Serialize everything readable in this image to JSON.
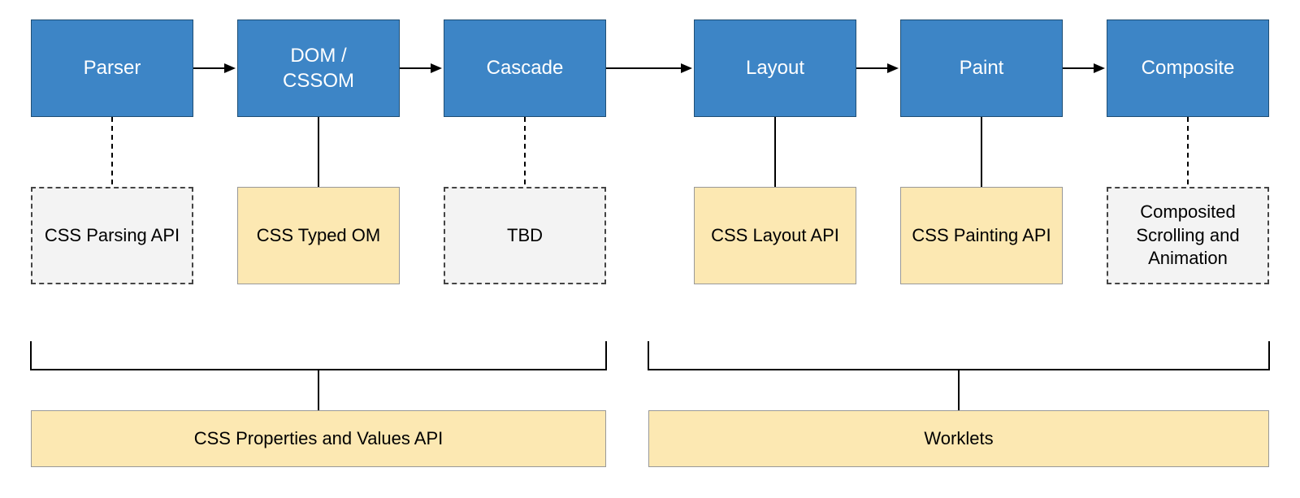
{
  "stages": {
    "parser": "Parser",
    "dom": "DOM /\nCSSOM",
    "cascade": "Cascade",
    "layout": "Layout",
    "paint": "Paint",
    "composite": "Composite"
  },
  "apis": {
    "cssParsing": "CSS Parsing API",
    "cssTypedOM": "CSS Typed OM",
    "tbd": "TBD",
    "cssLayout": "CSS Layout API",
    "cssPainting": "CSS Painting API",
    "composited": "Composited Scrolling and Animation"
  },
  "groups": {
    "propsValues": "CSS Properties and Values API",
    "worklets": "Worklets"
  }
}
